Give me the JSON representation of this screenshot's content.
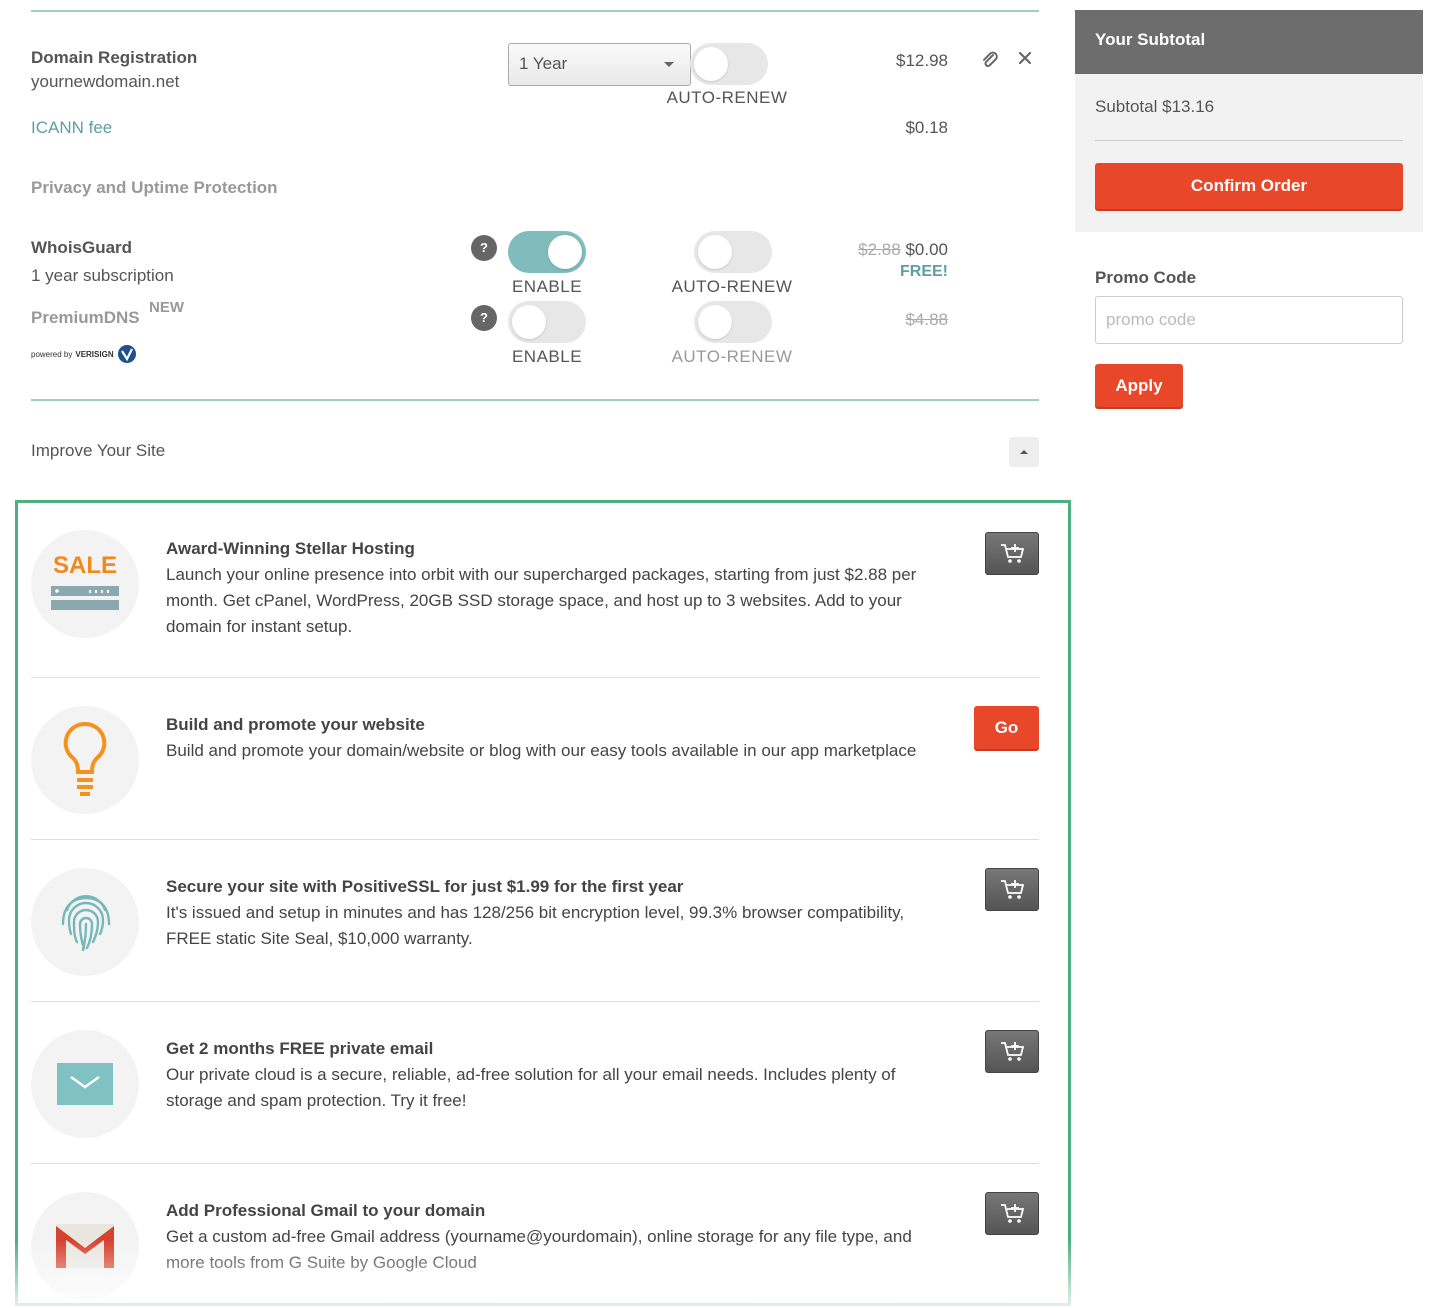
{
  "domain": {
    "title": "Domain Registration",
    "name": "yournewdomain.net",
    "period": "1 Year",
    "auto_renew_label": "AUTO-RENEW",
    "price": "$12.98",
    "icann_label": "ICANN fee",
    "icann_price": "$0.18"
  },
  "privacy": {
    "heading": "Privacy and Uptime Protection",
    "whoisguard": {
      "title": "WhoisGuard",
      "subtitle": "1 year subscription",
      "help": "?",
      "enable_label": "ENABLE",
      "enabled": true,
      "auto_renew_label": "AUTO-RENEW",
      "old_price": "$2.88",
      "price": "$0.00",
      "free": "FREE!"
    },
    "premiumdns": {
      "title": "PremiumDNS",
      "badge": "NEW",
      "powered_prefix": "powered by",
      "powered_brand": "VERISIGN",
      "help": "?",
      "enable_label": "ENABLE",
      "enabled": false,
      "auto_renew_label": "AUTO-RENEW",
      "old_price": "$4.88"
    }
  },
  "improve": {
    "heading": "Improve Your Site",
    "collapse_icon": "caret-up-icon"
  },
  "upsells": [
    {
      "icon": "sale-server-icon",
      "badge": "SALE",
      "title": "Award-Winning Stellar Hosting",
      "desc": "Launch your online presence into orbit with our supercharged packages, starting from just $2.88 per month. Get cPanel, WordPress, 20GB SSD storage space, and host up to 3 websites. Add to your domain for instant setup.",
      "action": "cart"
    },
    {
      "icon": "lightbulb-icon",
      "title": "Build and promote your website",
      "desc": "Build and promote your domain/website or blog with our easy tools available in our app marketplace",
      "action": "go",
      "action_label": "Go"
    },
    {
      "icon": "fingerprint-icon",
      "title": "Secure your site with PositiveSSL for just $1.99 for the first year",
      "desc": "It's issued and setup in minutes and has 128/256 bit encryption level, 99.3% browser compatibility, FREE static Site Seal, $10,000 warranty.",
      "action": "cart"
    },
    {
      "icon": "envelope-icon",
      "title": "Get 2 months FREE private email",
      "desc": "Our private cloud is a secure, reliable, ad-free solution for all your email needs. Includes plenty of storage and spam protection. Try it free!",
      "action": "cart"
    },
    {
      "icon": "gmail-icon",
      "title": "Add Professional Gmail to your domain",
      "desc": "Get a custom ad-free Gmail address (yourname@yourdomain), online storage for any file type, and more tools from G Suite by Google Cloud",
      "action": "cart"
    }
  ],
  "sidebar": {
    "header": "Your Subtotal",
    "subtotal_label": "Subtotal",
    "subtotal_value": "$13.16",
    "confirm": "Confirm Order",
    "promo_heading": "Promo Code",
    "promo_placeholder": "promo code",
    "apply": "Apply"
  },
  "colors": {
    "accent": "#e8472a",
    "teal": "#7fbcbb",
    "highlight_border": "#4fae82"
  }
}
